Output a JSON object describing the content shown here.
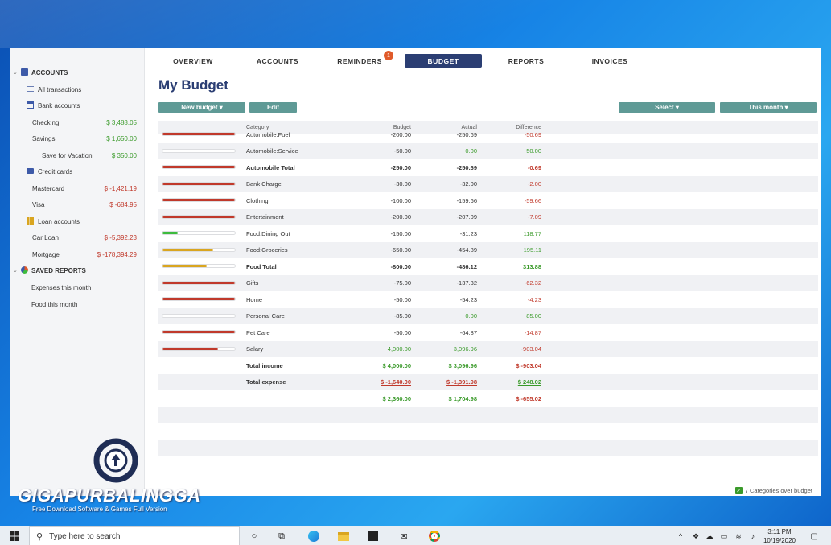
{
  "nav": {
    "tabs": [
      {
        "label": "OVERVIEW"
      },
      {
        "label": "ACCOUNTS"
      },
      {
        "label": "REMINDERS",
        "badge": "1"
      },
      {
        "label": "BUDGET",
        "active": true
      },
      {
        "label": "REPORTS"
      },
      {
        "label": "INVOICES"
      }
    ]
  },
  "sidebar": {
    "accounts_header": "ACCOUNTS",
    "all_transactions": "All transactions",
    "bank_accounts": "Bank accounts",
    "checking": {
      "label": "Checking",
      "amount": "$ 3,488.05"
    },
    "savings": {
      "label": "Savings",
      "amount": "$ 1,650.00"
    },
    "save_vacation": {
      "label": "Save for Vacation",
      "amount": "$ 350.00"
    },
    "credit_cards": "Credit cards",
    "mastercard": {
      "label": "Mastercard",
      "amount": "$ -1,421.19"
    },
    "visa": {
      "label": "Visa",
      "amount": "$ -684.95"
    },
    "loan_accounts": "Loan accounts",
    "car_loan": {
      "label": "Car Loan",
      "amount": "$ -5,392.23"
    },
    "mortgage": {
      "label": "Mortgage",
      "amount": "$ -178,394.29"
    },
    "saved_reports_header": "SAVED REPORTS",
    "report1": "Expenses this month",
    "report2": "Food this month"
  },
  "main": {
    "title": "My Budget",
    "new_budget_button": "New budget ▾",
    "edit_button": "Edit",
    "select_button": "Select ▾",
    "period_button": "This month ▾",
    "headers": {
      "category": "Category",
      "budget": "Budget",
      "actual": "Actual",
      "difference": "Difference"
    },
    "rows": [
      {
        "category": "Automobile:Fuel",
        "budget": "-200.00",
        "actual": "-250.69",
        "difference": "-50.69",
        "progress": 1.0,
        "bar": "red",
        "type": "normal",
        "diff_color": "neg"
      },
      {
        "category": "Automobile:Service",
        "budget": "-50.00",
        "actual": "0.00",
        "difference": "50.00",
        "progress": 0.0,
        "bar": "none",
        "type": "normal",
        "diff_color": "pos",
        "actual_color": "pos"
      },
      {
        "category": "Automobile Total",
        "budget": "-250.00",
        "actual": "-250.69",
        "difference": "-0.69",
        "progress": 1.0,
        "bar": "red",
        "type": "total",
        "diff_color": "neg"
      },
      {
        "category": "Bank Charge",
        "budget": "-30.00",
        "actual": "-32.00",
        "difference": "-2.00",
        "progress": 1.0,
        "bar": "red",
        "type": "normal",
        "diff_color": "neg"
      },
      {
        "category": "Clothing",
        "budget": "-100.00",
        "actual": "-159.66",
        "difference": "-59.66",
        "progress": 1.0,
        "bar": "red",
        "type": "normal",
        "diff_color": "neg"
      },
      {
        "category": "Entertainment",
        "budget": "-200.00",
        "actual": "-207.09",
        "difference": "-7.09",
        "progress": 1.0,
        "bar": "red",
        "type": "normal",
        "diff_color": "neg"
      },
      {
        "category": "Food:Dining Out",
        "budget": "-150.00",
        "actual": "-31.23",
        "difference": "118.77",
        "progress": 0.21,
        "bar": "green",
        "type": "normal",
        "diff_color": "pos"
      },
      {
        "category": "Food:Groceries",
        "budget": "-650.00",
        "actual": "-454.89",
        "difference": "195.11",
        "progress": 0.7,
        "bar": "yellow",
        "type": "normal",
        "diff_color": "pos"
      },
      {
        "category": "Food Total",
        "budget": "-800.00",
        "actual": "-486.12",
        "difference": "313.88",
        "progress": 0.61,
        "bar": "yellow",
        "type": "total",
        "diff_color": "pos"
      },
      {
        "category": "Gifts",
        "budget": "-75.00",
        "actual": "-137.32",
        "difference": "-62.32",
        "progress": 1.0,
        "bar": "red",
        "type": "normal",
        "diff_color": "neg"
      },
      {
        "category": "Home",
        "budget": "-50.00",
        "actual": "-54.23",
        "difference": "-4.23",
        "progress": 1.0,
        "bar": "red",
        "type": "normal",
        "diff_color": "neg"
      },
      {
        "category": "Personal Care",
        "budget": "-85.00",
        "actual": "0.00",
        "difference": "85.00",
        "progress": 0.0,
        "bar": "none",
        "type": "normal",
        "diff_color": "pos",
        "actual_color": "pos"
      },
      {
        "category": "Pet Care",
        "budget": "-50.00",
        "actual": "-64.87",
        "difference": "-14.87",
        "progress": 1.0,
        "bar": "red",
        "type": "normal",
        "diff_color": "neg"
      },
      {
        "category": "Salary",
        "budget": "4,000.00",
        "actual": "3,096.96",
        "difference": "-903.04",
        "progress": 0.77,
        "bar": "red",
        "type": "normal",
        "diff_color": "neg",
        "budget_color": "pos",
        "actual_color": "pos"
      },
      {
        "category": "Total income",
        "budget": "$ 4,000.00",
        "actual": "$ 3,096.96",
        "difference": "$ -903.04",
        "progress": null,
        "bar": "none",
        "type": "summary",
        "diff_color": "neg",
        "budget_color": "pos",
        "actual_color": "pos"
      },
      {
        "category": "Total expense",
        "budget": "$ -1,640.00",
        "actual": "$ -1,391.98",
        "difference": "$ 248.02",
        "progress": null,
        "bar": "none",
        "type": "summary-under",
        "diff_color": "pos",
        "budget_color": "neg",
        "actual_color": "neg"
      },
      {
        "category": "",
        "budget": "$ 2,360.00",
        "actual": "$ 1,704.98",
        "difference": "$ -655.02",
        "progress": null,
        "bar": "none",
        "type": "summary",
        "diff_color": "neg",
        "budget_color": "pos",
        "actual_color": "pos"
      }
    ],
    "status": "7 Categories over budget"
  },
  "watermark": {
    "title": "GIGAPURBALINGGA",
    "subtitle": "Free Download Software & Games Full Version"
  },
  "taskbar": {
    "search_placeholder": "Type here to search",
    "time": "3:11 PM",
    "date": "10/19/2020"
  },
  "colors": {
    "red": "#c0392b",
    "green": "#3dbb3d",
    "yellow": "#d9a520",
    "accent": "#2b3e73",
    "button": "#5f9a96"
  }
}
